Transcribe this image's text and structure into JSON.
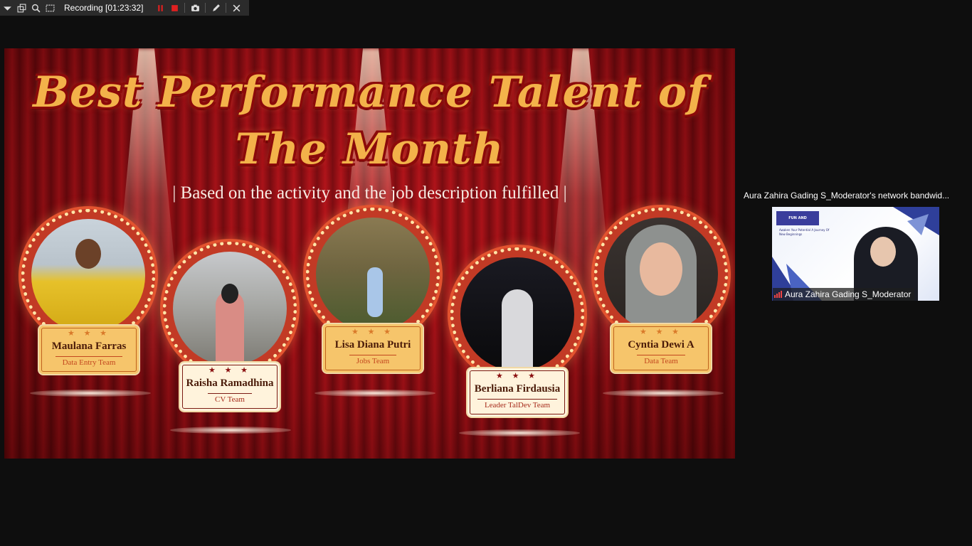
{
  "toolbar": {
    "recording_label": "Recording [01:23:32]",
    "icons": [
      "chevron-down-icon",
      "restore-window-icon",
      "magnify-icon",
      "select-area-icon",
      "pause-icon",
      "stop-icon",
      "camera-icon",
      "pen-icon",
      "close-icon"
    ],
    "accent_color": "#e02020"
  },
  "slide": {
    "title_line1": "Best Performance Talent of",
    "title_line2": "The Month",
    "subtitle": "| Based on the activity and the job description fulfilled |",
    "stars": "★ ★ ★",
    "members": [
      {
        "name": "Maulana Farras",
        "team": "Data Entry Team"
      },
      {
        "name": "Raisha Ramadhina",
        "team": "CV Team"
      },
      {
        "name": "Lisa Diana Putri",
        "team": "Jobs Team"
      },
      {
        "name": "Berliana Firdausia",
        "team": "Leader TalDev Team"
      },
      {
        "name": "Cyntia Dewi A",
        "team": "Data Team"
      }
    ]
  },
  "video": {
    "bandwidth_notice": "Aura Zahira Gading S_Moderator's network bandwid...",
    "participant_name": "Aura Zahira Gading S_Moderator",
    "background_badge": "FUN AND FELLOWSHIP",
    "background_text": "Awaken Your Potential A Journey Of New Beginnings"
  }
}
